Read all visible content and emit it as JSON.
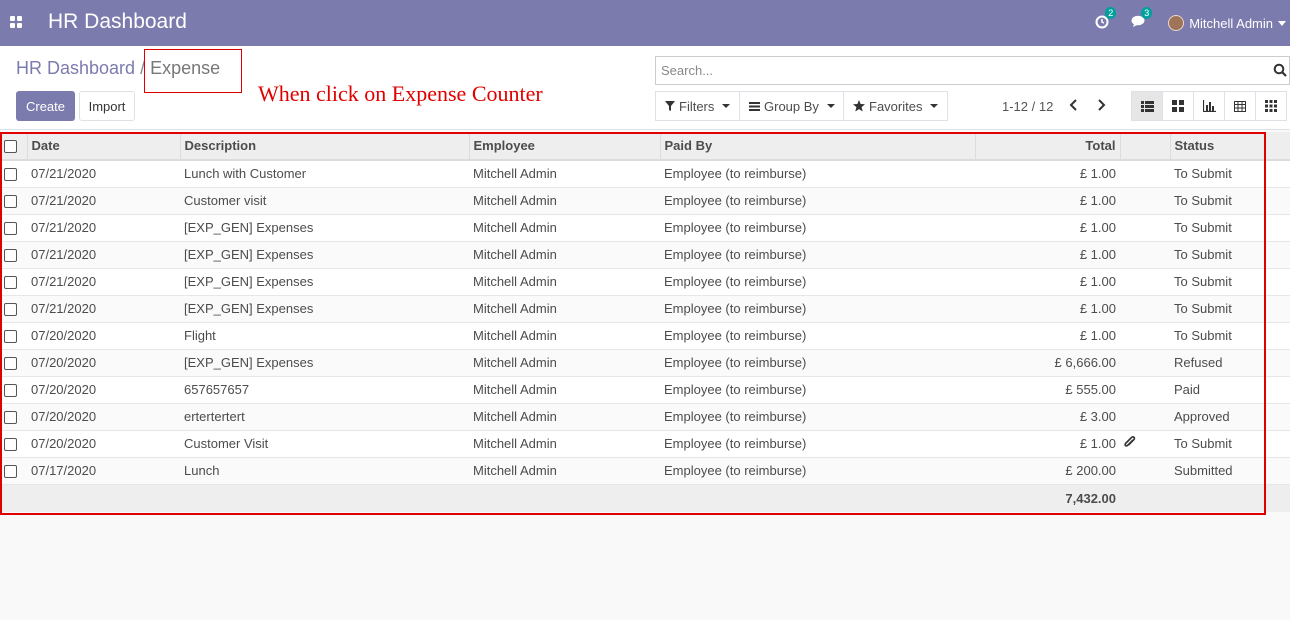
{
  "topbar": {
    "app_title": "HR Dashboard",
    "activity_count": "2",
    "messages_count": "3",
    "user_name": "Mitchell Admin",
    "icons": [
      "apps-icon",
      "clock-icon",
      "comments-icon",
      "user-avatar"
    ]
  },
  "breadcrumb": {
    "parent": "HR Dashboard",
    "separator": "/",
    "current": "Expense"
  },
  "annotation": "When click on Expense Counter",
  "buttons": {
    "create": "Create",
    "import": "Import"
  },
  "search": {
    "placeholder": "Search..."
  },
  "filters": {
    "filters": "Filters",
    "group_by": "Group By",
    "favorites": "Favorites"
  },
  "pager": {
    "text": "1-12 / 12"
  },
  "views": [
    "list",
    "kanban",
    "graph",
    "pivot",
    "grid"
  ],
  "colors": {
    "brand": "#7c7bad",
    "annotation_red": "#e00000",
    "badge": "#00a09d"
  },
  "table": {
    "headers": {
      "date": "Date",
      "description": "Description",
      "employee": "Employee",
      "paid_by": "Paid By",
      "total": "Total",
      "status": "Status"
    },
    "rows": [
      {
        "date": "07/21/2020",
        "description": "Lunch with Customer",
        "employee": "Mitchell Admin",
        "paid_by": "Employee (to reimburse)",
        "total": "£ 1.00",
        "attachment": false,
        "status": "To Submit"
      },
      {
        "date": "07/21/2020",
        "description": "Customer visit",
        "employee": "Mitchell Admin",
        "paid_by": "Employee (to reimburse)",
        "total": "£ 1.00",
        "attachment": false,
        "status": "To Submit"
      },
      {
        "date": "07/21/2020",
        "description": "[EXP_GEN] Expenses",
        "employee": "Mitchell Admin",
        "paid_by": "Employee (to reimburse)",
        "total": "£ 1.00",
        "attachment": false,
        "status": "To Submit"
      },
      {
        "date": "07/21/2020",
        "description": "[EXP_GEN] Expenses",
        "employee": "Mitchell Admin",
        "paid_by": "Employee (to reimburse)",
        "total": "£ 1.00",
        "attachment": false,
        "status": "To Submit"
      },
      {
        "date": "07/21/2020",
        "description": "[EXP_GEN] Expenses",
        "employee": "Mitchell Admin",
        "paid_by": "Employee (to reimburse)",
        "total": "£ 1.00",
        "attachment": false,
        "status": "To Submit"
      },
      {
        "date": "07/21/2020",
        "description": "[EXP_GEN] Expenses",
        "employee": "Mitchell Admin",
        "paid_by": "Employee (to reimburse)",
        "total": "£ 1.00",
        "attachment": false,
        "status": "To Submit"
      },
      {
        "date": "07/20/2020",
        "description": "Flight",
        "employee": "Mitchell Admin",
        "paid_by": "Employee (to reimburse)",
        "total": "£ 1.00",
        "attachment": false,
        "status": "To Submit"
      },
      {
        "date": "07/20/2020",
        "description": "[EXP_GEN] Expenses",
        "employee": "Mitchell Admin",
        "paid_by": "Employee (to reimburse)",
        "total": "£ 6,666.00",
        "attachment": false,
        "status": "Refused"
      },
      {
        "date": "07/20/2020",
        "description": "657657657",
        "employee": "Mitchell Admin",
        "paid_by": "Employee (to reimburse)",
        "total": "£ 555.00",
        "attachment": false,
        "status": "Paid"
      },
      {
        "date": "07/20/2020",
        "description": "ertertertert",
        "employee": "Mitchell Admin",
        "paid_by": "Employee (to reimburse)",
        "total": "£ 3.00",
        "attachment": false,
        "status": "Approved"
      },
      {
        "date": "07/20/2020",
        "description": "Customer Visit",
        "employee": "Mitchell Admin",
        "paid_by": "Employee (to reimburse)",
        "total": "£ 1.00",
        "attachment": true,
        "status": "To Submit"
      },
      {
        "date": "07/17/2020",
        "description": "Lunch",
        "employee": "Mitchell Admin",
        "paid_by": "Employee (to reimburse)",
        "total": "£ 200.00",
        "attachment": false,
        "status": "Submitted"
      }
    ],
    "footer_total": "7,432.00"
  }
}
